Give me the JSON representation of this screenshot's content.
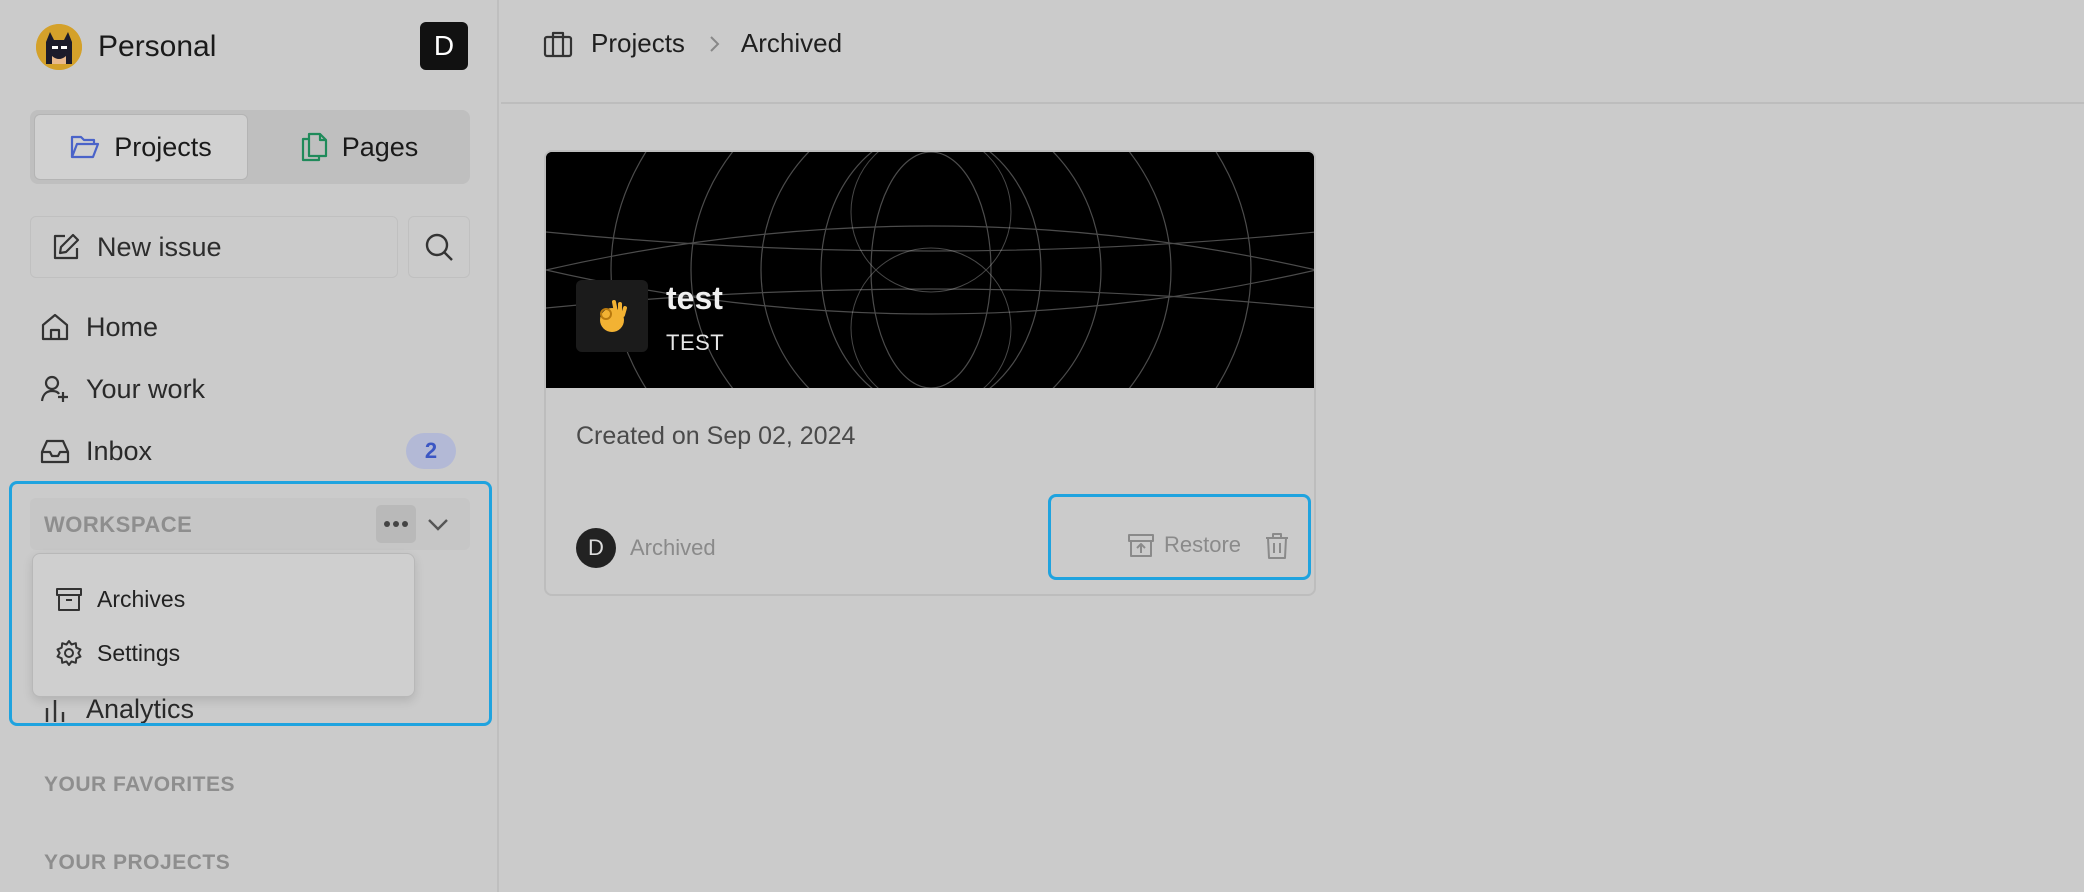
{
  "workspace": {
    "name": "Personal",
    "user_initial": "D"
  },
  "toggle": {
    "projects_label": "Projects",
    "pages_label": "Pages"
  },
  "actions": {
    "new_issue_label": "New issue"
  },
  "nav": {
    "home": "Home",
    "your_work": "Your work",
    "inbox": "Inbox",
    "inbox_count": "2",
    "analytics": "Analytics"
  },
  "workspace_section": {
    "label": "WORKSPACE",
    "menu": {
      "archives": "Archives",
      "settings": "Settings"
    }
  },
  "sections": {
    "favorites": "YOUR FAVORITES",
    "projects": "YOUR PROJECTS"
  },
  "breadcrumb": {
    "root": "Projects",
    "current": "Archived"
  },
  "project_card": {
    "name": "test",
    "identifier": "TEST",
    "emoji": "👌",
    "created_text": "Created on Sep 02, 2024",
    "owner_initial": "D",
    "status": "Archived",
    "restore_label": "Restore"
  },
  "colors": {
    "highlight": "#1fa3df",
    "accent": "#3b56c4"
  }
}
